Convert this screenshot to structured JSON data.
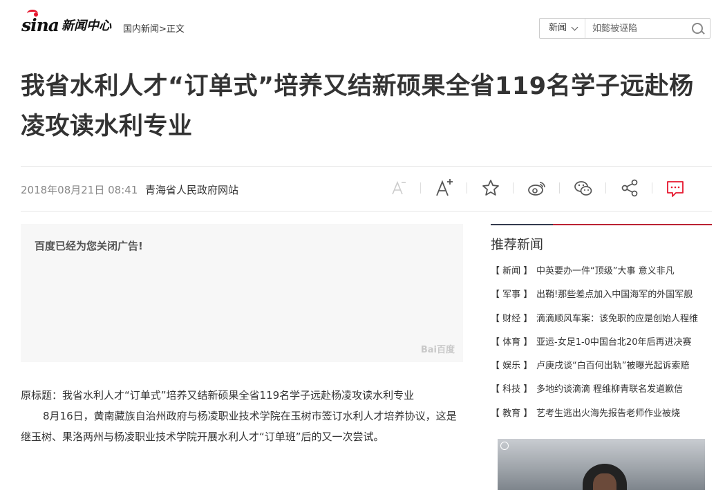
{
  "header": {
    "logo_sina": "sina",
    "logo_channel": "新闻中心",
    "breadcrumb": [
      "国内新闻",
      ">",
      "正文"
    ]
  },
  "search": {
    "category": "新闻",
    "placeholder": "如懿被诬陷"
  },
  "article": {
    "title": "我省水利人才“订单式”培养又结新硕果全省119名学子远赴杨凌攻读水利专业",
    "date": "2018年08月21日 08:41",
    "source": "青海省人民政府网站",
    "paragraphs": [
      "原标题：我省水利人才“订单式”培养又结新硕果全省119名学子远赴杨凌攻读水利专业",
      "8月16日，黄南藏族自治州政府与杨凌职业技术学院在玉树市签订水利人才培养协议，这是继玉树、果洛两州与杨凌职业技术学院开展水利人才“订单班”后的又一次尝试。"
    ]
  },
  "toolbar": {
    "icons": [
      "font-decrease-icon",
      "font-increase-icon",
      "star-icon",
      "weibo-icon",
      "wechat-icon",
      "share-icon",
      "comment-icon"
    ],
    "accent": "#e6162d"
  },
  "ad": {
    "closed_text": "百度已经为您关闭广告!",
    "logo_text": "Bai百度"
  },
  "sidebar": {
    "title": "推荐新闻",
    "items": [
      {
        "category": "【 新闻 】",
        "text": "中英要办一件“顶级”大事 意义非凡"
      },
      {
        "category": "【 军事 】",
        "text": "出鞘!那些差点加入中国海军的外国军舰"
      },
      {
        "category": "【 财经 】",
        "text": "滴滴顺风车案：该免职的应是创始人程维"
      },
      {
        "category": "【 体育 】",
        "text": "亚运-女足1-0中国台北20年后再进决赛"
      },
      {
        "category": "【 娱乐 】",
        "text": "卢庚戌谈“白百何出轨”被曝光起诉索赔"
      },
      {
        "category": "【 科技 】",
        "text": "多地约谈滴滴 程维柳青联名发道歉信"
      },
      {
        "category": "【 教育 】",
        "text": "艺考生逃出火海先报告老师作业被烧"
      }
    ]
  }
}
